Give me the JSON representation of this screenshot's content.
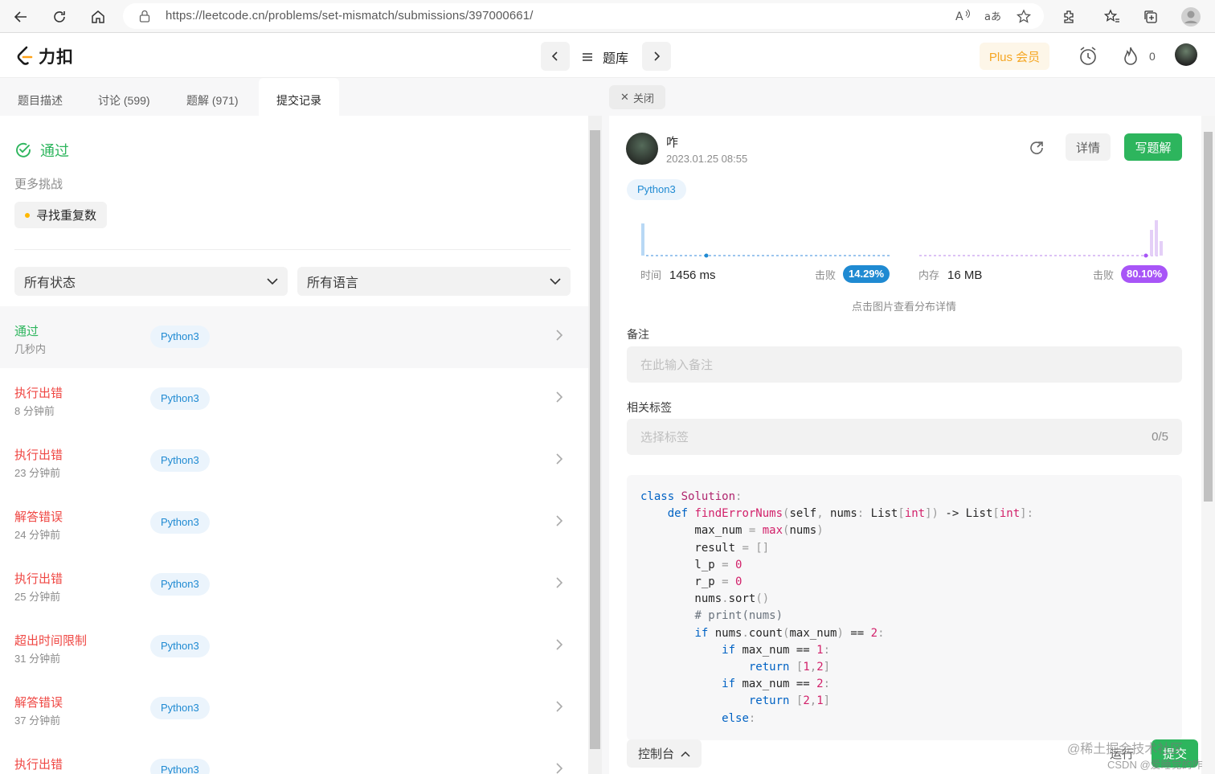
{
  "browser": {
    "url": "https://leetcode.cn/problems/set-mismatch/submissions/397000661/"
  },
  "nav": {
    "logo": "力扣",
    "tiku": "题库",
    "plus": "Plus 会员",
    "streak": "0"
  },
  "tabs": [
    "题目描述",
    "讨论 (599)",
    "题解 (971)",
    "提交记录"
  ],
  "left": {
    "status": "通过",
    "more": "更多挑战",
    "chip": "寻找重复数",
    "filter_status": "所有状态",
    "filter_lang": "所有语言",
    "rows": [
      {
        "status": "通过",
        "time": "几秒内",
        "lang": "Python3",
        "color": "green"
      },
      {
        "status": "执行出错",
        "time": "8 分钟前",
        "lang": "Python3",
        "color": "red"
      },
      {
        "status": "执行出错",
        "time": "23 分钟前",
        "lang": "Python3",
        "color": "red"
      },
      {
        "status": "解答错误",
        "time": "24 分钟前",
        "lang": "Python3",
        "color": "red"
      },
      {
        "status": "执行出错",
        "time": "25 分钟前",
        "lang": "Python3",
        "color": "red"
      },
      {
        "status": "超出时间限制",
        "time": "31 分钟前",
        "lang": "Python3",
        "color": "red"
      },
      {
        "status": "解答错误",
        "time": "37 分钟前",
        "lang": "Python3",
        "color": "red"
      },
      {
        "status": "执行出错",
        "time": "",
        "lang": "Python3",
        "color": "red"
      }
    ]
  },
  "right": {
    "close": "关闭",
    "user": "咋",
    "date": "2023.01.25 08:55",
    "detail": "详情",
    "write": "写题解",
    "lang": "Python3",
    "time_label": "时间",
    "time_value": "1456 ms",
    "beat_label": "击败",
    "time_beat": "14.29%",
    "mem_label": "内存",
    "mem_value": "16 MB",
    "mem_beat": "80.10%",
    "hint": "点击图片查看分布详情",
    "notes_label": "备注",
    "notes_placeholder": "在此输入备注",
    "tags_label": "相关标签",
    "tags_placeholder": "选择标签",
    "tags_count": "0/5",
    "code": [
      "class Solution:",
      "    def findErrorNums(self, nums: List[int]) -> List[int]:",
      "        max_num = max(nums)",
      "        result = []",
      "        l_p = 0",
      "        r_p = 0",
      "        nums.sort()",
      "        # print(nums)",
      "        if nums.count(max_num) == 2:",
      "            if max_num == 1:",
      "                return [1,2]",
      "            if max_num == 2:",
      "                return [2,1]",
      "            else:"
    ],
    "console": "控制台",
    "run": "运行",
    "submit": "提交"
  },
  "watermark": {
    "line1": "@稀土掘金技术社区",
    "line2": "CSDN @爱睡觉的咋"
  },
  "colors": {
    "green": "#2db55d",
    "red": "#ef4743",
    "blue": "#1f8ad2",
    "purple": "#a855f7"
  }
}
